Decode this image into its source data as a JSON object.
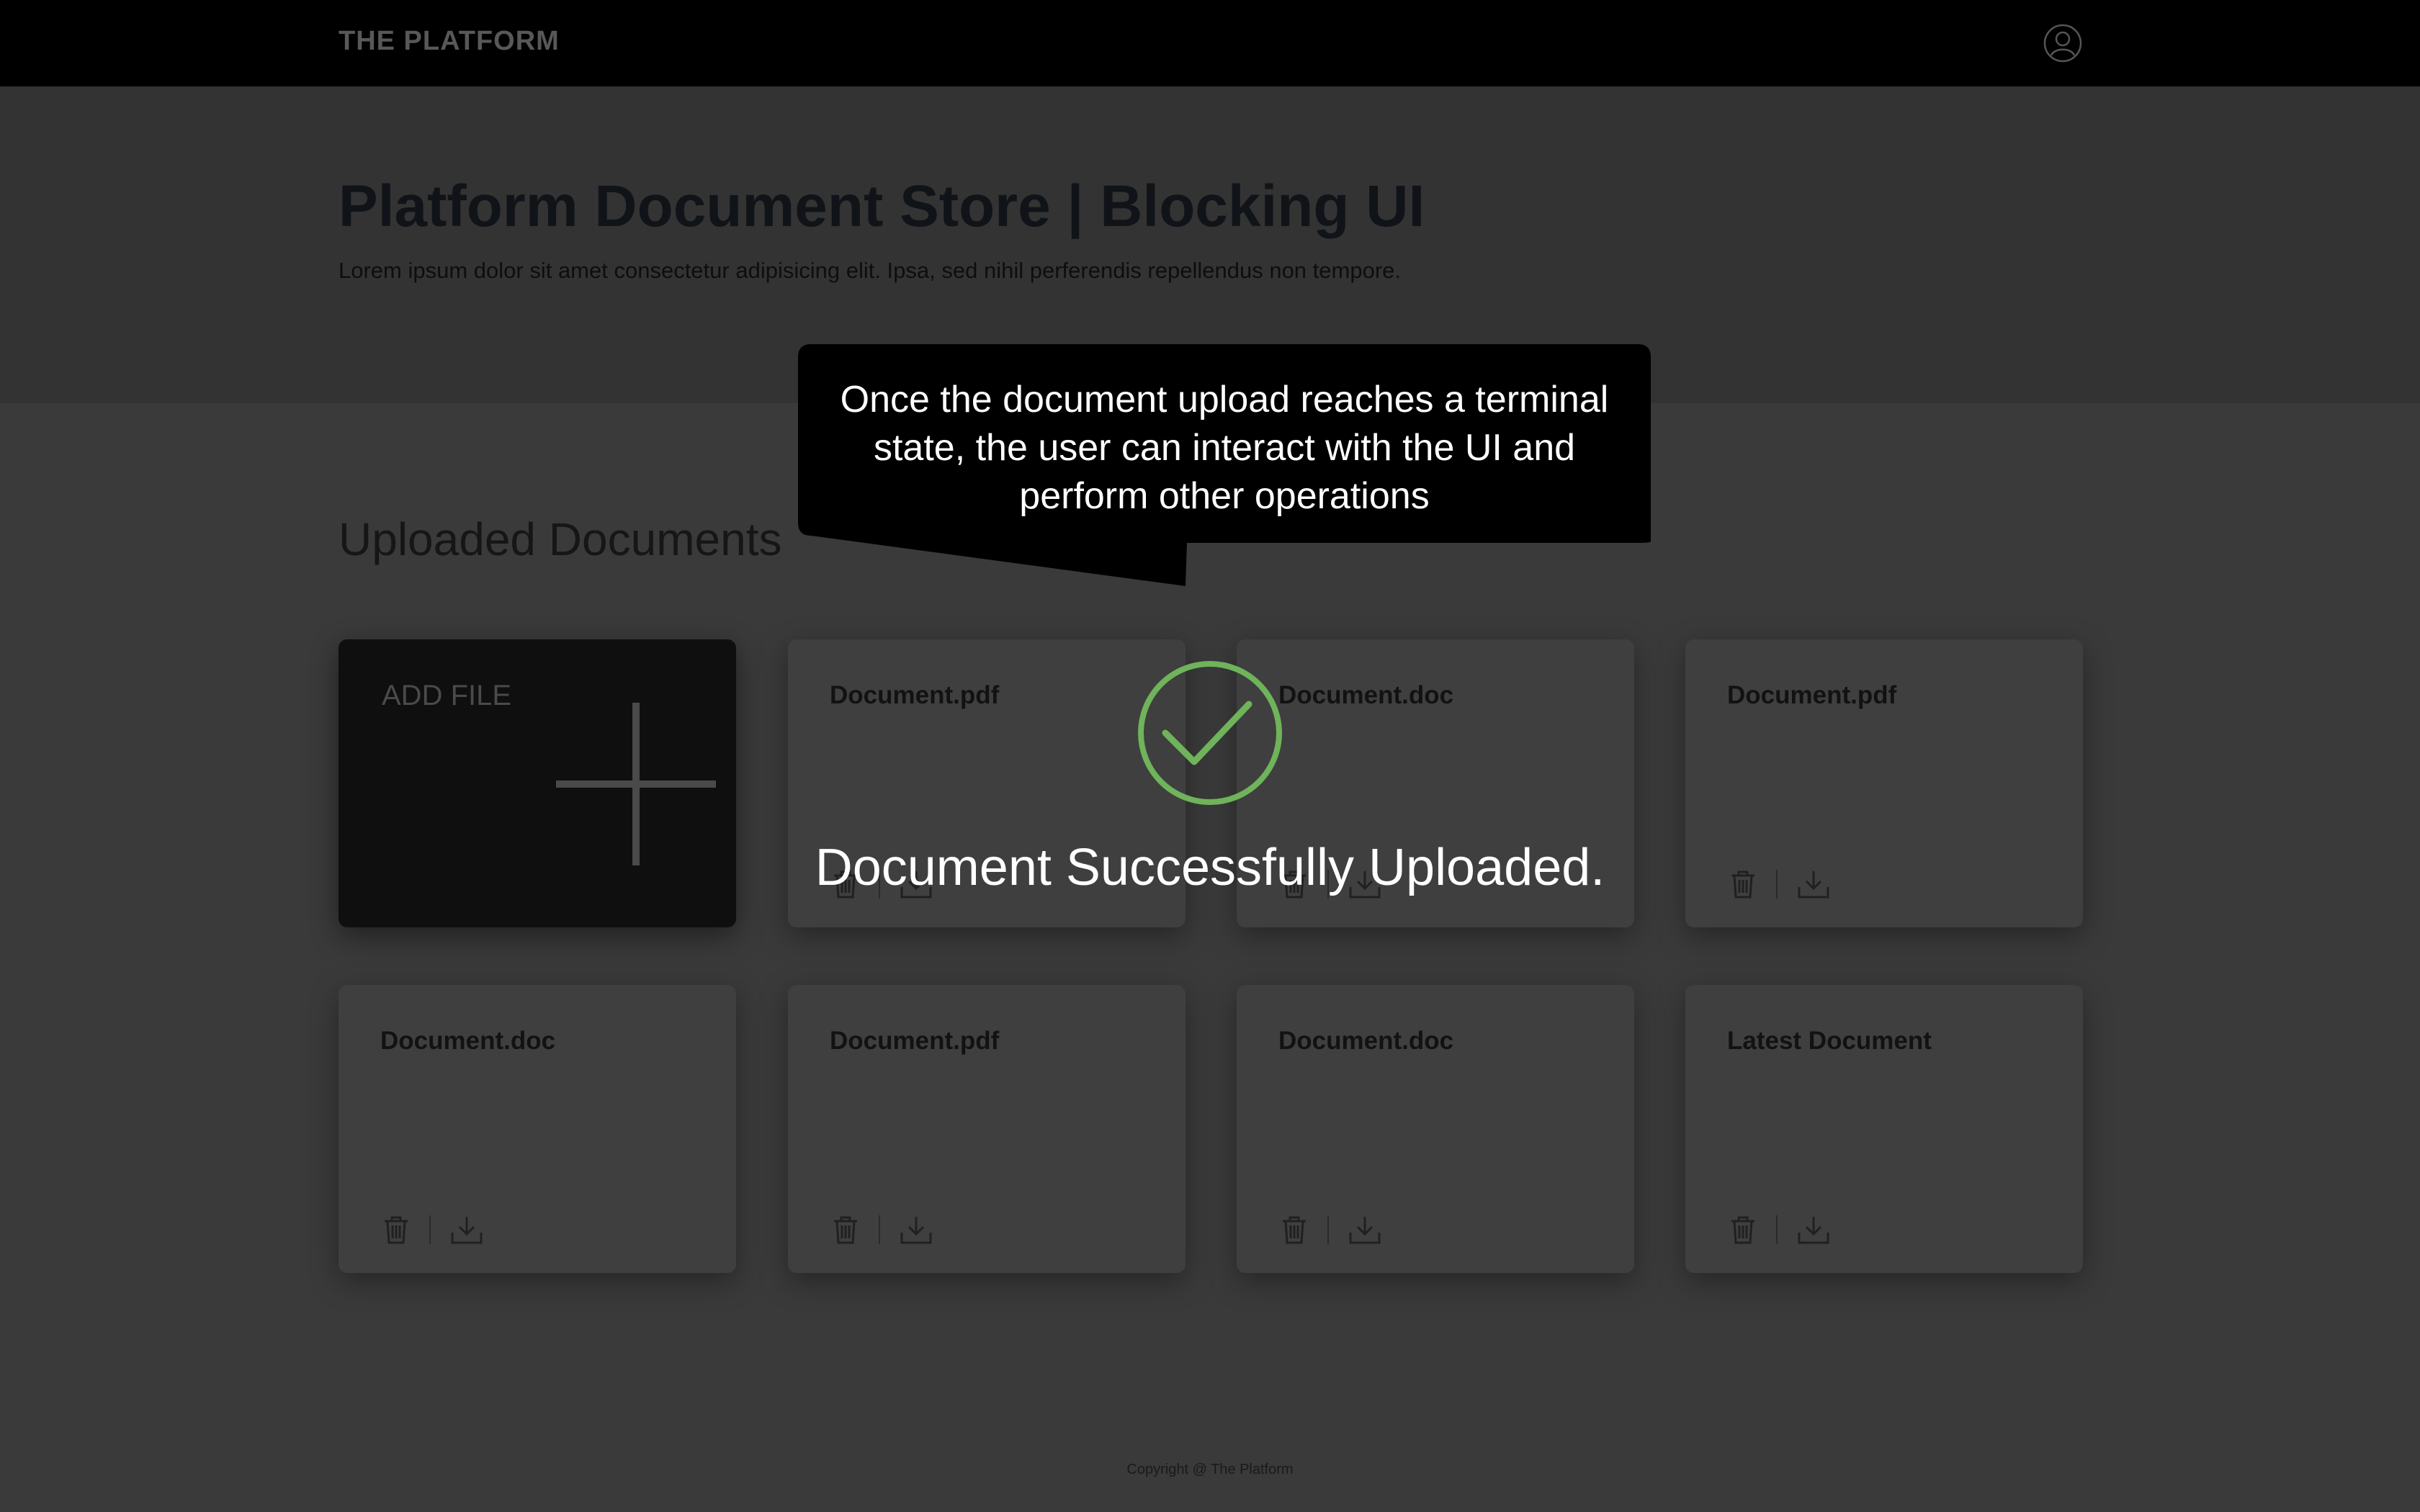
{
  "header": {
    "brand": "THE PLATFORM",
    "user_icon": "user-profile-icon"
  },
  "page": {
    "title": "Platform Document Store | Blocking UI",
    "subtitle": "Lorem ipsum dolor sit amet consectetur adipisicing elit. Ipsa, sed nihil perferendis repellendus non tempore."
  },
  "documents": {
    "section_title": "Uploaded Documents",
    "add_file_label": "ADD FILE",
    "items": [
      {
        "name": "Document.pdf"
      },
      {
        "name": "Document.doc"
      },
      {
        "name": "Document.pdf"
      },
      {
        "name": "Document.doc"
      },
      {
        "name": "Document.pdf"
      },
      {
        "name": "Document.doc"
      },
      {
        "name": "Latest Document"
      }
    ],
    "action_icons": [
      "trash-icon",
      "download-icon"
    ]
  },
  "callout": {
    "text": "Once the document upload reaches a terminal state, the user can interact with the UI and perform other operations"
  },
  "overlay": {
    "message": "Document Successfully Uploaded.",
    "icon": "check-circle-icon",
    "icon_color": "#6fb35a"
  },
  "footer": {
    "copyright": "Copyright @ The Platform"
  }
}
